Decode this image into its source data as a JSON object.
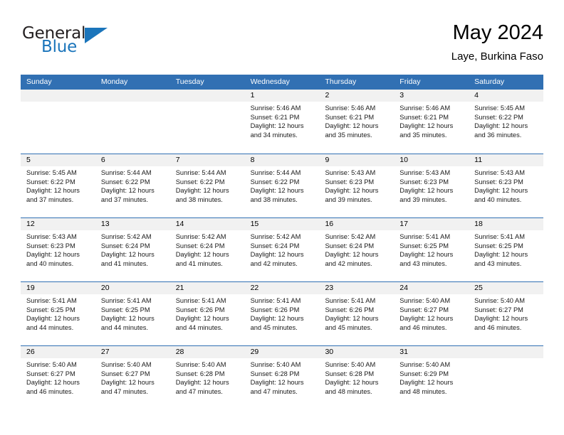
{
  "brand": {
    "name_top": "General",
    "name_bottom": "Blue",
    "accent_color": "#1b75bb",
    "text_color": "#231f20"
  },
  "header": {
    "title": "May 2024",
    "subtitle": "Laye, Burkina Faso"
  },
  "theme": {
    "header_bar_color": "#3170b3",
    "day_band_color": "#f1f1f1",
    "row_divider_color": "#3170b3",
    "body_background": "#ffffff"
  },
  "weekdays": [
    "Sunday",
    "Monday",
    "Tuesday",
    "Wednesday",
    "Thursday",
    "Friday",
    "Saturday"
  ],
  "labels": {
    "sunrise_prefix": "Sunrise:",
    "sunset_prefix": "Sunset:",
    "daylight_prefix": "Daylight:"
  },
  "weeks": [
    [
      {
        "day": "",
        "empty": true
      },
      {
        "day": "",
        "empty": true
      },
      {
        "day": "",
        "empty": true
      },
      {
        "day": "1",
        "sunrise": "Sunrise: 5:46 AM",
        "sunset": "Sunset: 6:21 PM",
        "daylight_line1": "Daylight: 12 hours",
        "daylight_line2": "and 34 minutes."
      },
      {
        "day": "2",
        "sunrise": "Sunrise: 5:46 AM",
        "sunset": "Sunset: 6:21 PM",
        "daylight_line1": "Daylight: 12 hours",
        "daylight_line2": "and 35 minutes."
      },
      {
        "day": "3",
        "sunrise": "Sunrise: 5:46 AM",
        "sunset": "Sunset: 6:21 PM",
        "daylight_line1": "Daylight: 12 hours",
        "daylight_line2": "and 35 minutes."
      },
      {
        "day": "4",
        "sunrise": "Sunrise: 5:45 AM",
        "sunset": "Sunset: 6:22 PM",
        "daylight_line1": "Daylight: 12 hours",
        "daylight_line2": "and 36 minutes."
      }
    ],
    [
      {
        "day": "5",
        "sunrise": "Sunrise: 5:45 AM",
        "sunset": "Sunset: 6:22 PM",
        "daylight_line1": "Daylight: 12 hours",
        "daylight_line2": "and 37 minutes."
      },
      {
        "day": "6",
        "sunrise": "Sunrise: 5:44 AM",
        "sunset": "Sunset: 6:22 PM",
        "daylight_line1": "Daylight: 12 hours",
        "daylight_line2": "and 37 minutes."
      },
      {
        "day": "7",
        "sunrise": "Sunrise: 5:44 AM",
        "sunset": "Sunset: 6:22 PM",
        "daylight_line1": "Daylight: 12 hours",
        "daylight_line2": "and 38 minutes."
      },
      {
        "day": "8",
        "sunrise": "Sunrise: 5:44 AM",
        "sunset": "Sunset: 6:22 PM",
        "daylight_line1": "Daylight: 12 hours",
        "daylight_line2": "and 38 minutes."
      },
      {
        "day": "9",
        "sunrise": "Sunrise: 5:43 AM",
        "sunset": "Sunset: 6:23 PM",
        "daylight_line1": "Daylight: 12 hours",
        "daylight_line2": "and 39 minutes."
      },
      {
        "day": "10",
        "sunrise": "Sunrise: 5:43 AM",
        "sunset": "Sunset: 6:23 PM",
        "daylight_line1": "Daylight: 12 hours",
        "daylight_line2": "and 39 minutes."
      },
      {
        "day": "11",
        "sunrise": "Sunrise: 5:43 AM",
        "sunset": "Sunset: 6:23 PM",
        "daylight_line1": "Daylight: 12 hours",
        "daylight_line2": "and 40 minutes."
      }
    ],
    [
      {
        "day": "12",
        "sunrise": "Sunrise: 5:43 AM",
        "sunset": "Sunset: 6:23 PM",
        "daylight_line1": "Daylight: 12 hours",
        "daylight_line2": "and 40 minutes."
      },
      {
        "day": "13",
        "sunrise": "Sunrise: 5:42 AM",
        "sunset": "Sunset: 6:24 PM",
        "daylight_line1": "Daylight: 12 hours",
        "daylight_line2": "and 41 minutes."
      },
      {
        "day": "14",
        "sunrise": "Sunrise: 5:42 AM",
        "sunset": "Sunset: 6:24 PM",
        "daylight_line1": "Daylight: 12 hours",
        "daylight_line2": "and 41 minutes."
      },
      {
        "day": "15",
        "sunrise": "Sunrise: 5:42 AM",
        "sunset": "Sunset: 6:24 PM",
        "daylight_line1": "Daylight: 12 hours",
        "daylight_line2": "and 42 minutes."
      },
      {
        "day": "16",
        "sunrise": "Sunrise: 5:42 AM",
        "sunset": "Sunset: 6:24 PM",
        "daylight_line1": "Daylight: 12 hours",
        "daylight_line2": "and 42 minutes."
      },
      {
        "day": "17",
        "sunrise": "Sunrise: 5:41 AM",
        "sunset": "Sunset: 6:25 PM",
        "daylight_line1": "Daylight: 12 hours",
        "daylight_line2": "and 43 minutes."
      },
      {
        "day": "18",
        "sunrise": "Sunrise: 5:41 AM",
        "sunset": "Sunset: 6:25 PM",
        "daylight_line1": "Daylight: 12 hours",
        "daylight_line2": "and 43 minutes."
      }
    ],
    [
      {
        "day": "19",
        "sunrise": "Sunrise: 5:41 AM",
        "sunset": "Sunset: 6:25 PM",
        "daylight_line1": "Daylight: 12 hours",
        "daylight_line2": "and 44 minutes."
      },
      {
        "day": "20",
        "sunrise": "Sunrise: 5:41 AM",
        "sunset": "Sunset: 6:25 PM",
        "daylight_line1": "Daylight: 12 hours",
        "daylight_line2": "and 44 minutes."
      },
      {
        "day": "21",
        "sunrise": "Sunrise: 5:41 AM",
        "sunset": "Sunset: 6:26 PM",
        "daylight_line1": "Daylight: 12 hours",
        "daylight_line2": "and 44 minutes."
      },
      {
        "day": "22",
        "sunrise": "Sunrise: 5:41 AM",
        "sunset": "Sunset: 6:26 PM",
        "daylight_line1": "Daylight: 12 hours",
        "daylight_line2": "and 45 minutes."
      },
      {
        "day": "23",
        "sunrise": "Sunrise: 5:41 AM",
        "sunset": "Sunset: 6:26 PM",
        "daylight_line1": "Daylight: 12 hours",
        "daylight_line2": "and 45 minutes."
      },
      {
        "day": "24",
        "sunrise": "Sunrise: 5:40 AM",
        "sunset": "Sunset: 6:27 PM",
        "daylight_line1": "Daylight: 12 hours",
        "daylight_line2": "and 46 minutes."
      },
      {
        "day": "25",
        "sunrise": "Sunrise: 5:40 AM",
        "sunset": "Sunset: 6:27 PM",
        "daylight_line1": "Daylight: 12 hours",
        "daylight_line2": "and 46 minutes."
      }
    ],
    [
      {
        "day": "26",
        "sunrise": "Sunrise: 5:40 AM",
        "sunset": "Sunset: 6:27 PM",
        "daylight_line1": "Daylight: 12 hours",
        "daylight_line2": "and 46 minutes."
      },
      {
        "day": "27",
        "sunrise": "Sunrise: 5:40 AM",
        "sunset": "Sunset: 6:27 PM",
        "daylight_line1": "Daylight: 12 hours",
        "daylight_line2": "and 47 minutes."
      },
      {
        "day": "28",
        "sunrise": "Sunrise: 5:40 AM",
        "sunset": "Sunset: 6:28 PM",
        "daylight_line1": "Daylight: 12 hours",
        "daylight_line2": "and 47 minutes."
      },
      {
        "day": "29",
        "sunrise": "Sunrise: 5:40 AM",
        "sunset": "Sunset: 6:28 PM",
        "daylight_line1": "Daylight: 12 hours",
        "daylight_line2": "and 47 minutes."
      },
      {
        "day": "30",
        "sunrise": "Sunrise: 5:40 AM",
        "sunset": "Sunset: 6:28 PM",
        "daylight_line1": "Daylight: 12 hours",
        "daylight_line2": "and 48 minutes."
      },
      {
        "day": "31",
        "sunrise": "Sunrise: 5:40 AM",
        "sunset": "Sunset: 6:29 PM",
        "daylight_line1": "Daylight: 12 hours",
        "daylight_line2": "and 48 minutes."
      },
      {
        "day": "",
        "empty": true
      }
    ]
  ]
}
